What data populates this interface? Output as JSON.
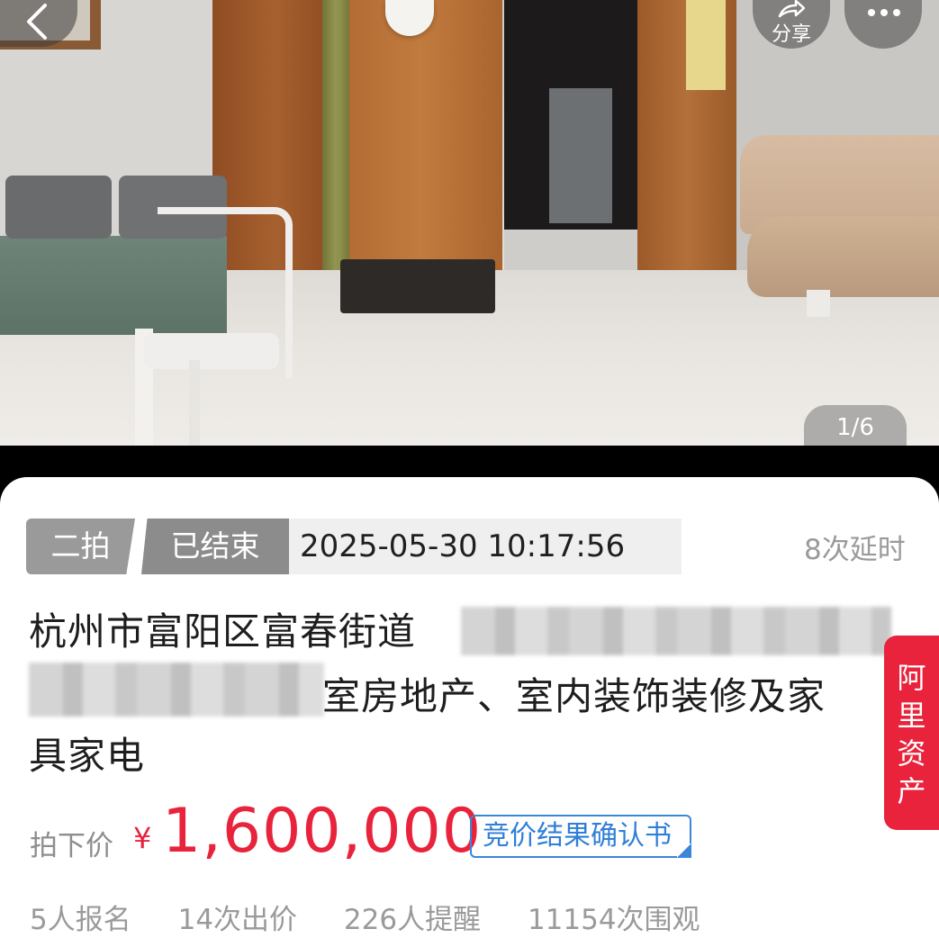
{
  "gallery": {
    "pager": "1/6",
    "back_icon": "chevron-left-icon",
    "share_icon": "share-icon",
    "share_label": "分享",
    "more_icon": "more-dots-icon"
  },
  "auction": {
    "round_tag": "二拍",
    "status_tag": "已结束",
    "end_time": "2025-05-30 10:17:56",
    "extensions": "8次延时",
    "title_line1": "杭州市富阳区富春街道",
    "title_line2": "室房地产、室内装饰装修及家",
    "title_line3": "具家电",
    "price_label": "拍下价",
    "currency": "¥",
    "price": "1,600,000",
    "result_doc_link": "竞价结果确认书",
    "brand_tab": "阿里资产"
  },
  "stats": {
    "signups": "5人报名",
    "bids": "14次出价",
    "reminders": "226人提醒",
    "views": "11154次围观"
  },
  "colors": {
    "accent_red": "#e8233b",
    "link_blue": "#2f7fd6",
    "tag_gray": "#9a9a9a"
  }
}
